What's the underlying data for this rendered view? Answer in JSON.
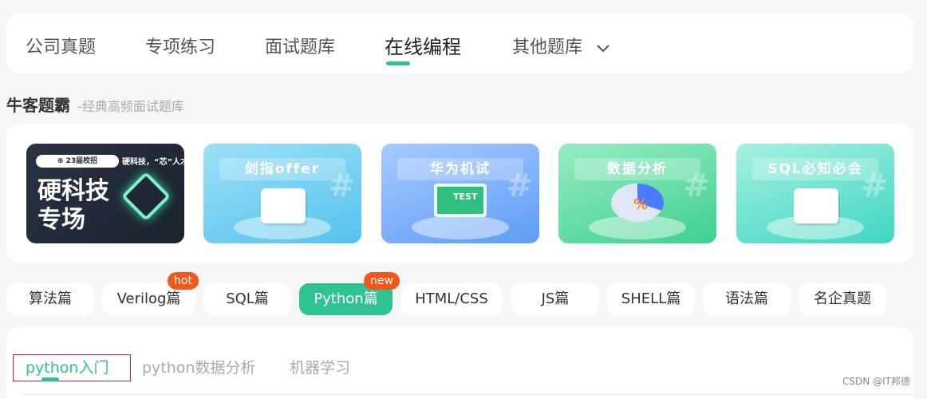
{
  "nav": {
    "items": [
      {
        "label": "公司真题"
      },
      {
        "label": "专项练习"
      },
      {
        "label": "面试题库"
      },
      {
        "label": "在线编程"
      },
      {
        "label": "其他题库"
      }
    ],
    "active_index": 3,
    "more_icon": "chevron-down-icon"
  },
  "brand": {
    "title": "牛客题霸",
    "subtitle": "-经典高频面试题库"
  },
  "banners": {
    "hardtech": {
      "tag": "⊕ 23届校招",
      "tag2": "硬科技，“芯”人才",
      "headline": "硬科技\n专场"
    },
    "jianzhi": {
      "title": "剑指offer"
    },
    "huawei": {
      "title": "华为机试",
      "screen_text": "TEST"
    },
    "data": {
      "title": "数据分析",
      "symbol": "%"
    },
    "sql": {
      "title": "SQL必知必会"
    }
  },
  "tags": {
    "items": [
      {
        "label": "算法篇"
      },
      {
        "label": "Verilog篇",
        "badge": "hot"
      },
      {
        "label": "SQL篇"
      },
      {
        "label": "Python篇",
        "badge": "new"
      },
      {
        "label": "HTML/CSS"
      },
      {
        "label": "JS篇"
      },
      {
        "label": "SHELL篇"
      },
      {
        "label": "语法篇"
      },
      {
        "label": "名企真题"
      }
    ],
    "active_index": 3
  },
  "subtabs": {
    "items": [
      {
        "label": "python入门"
      },
      {
        "label": "python数据分析"
      },
      {
        "label": "机器学习"
      }
    ],
    "active_index": 0
  },
  "watermark": "CSDN @IT邦德",
  "colors": {
    "accent": "#2ec295",
    "badge": "#f2571c"
  }
}
